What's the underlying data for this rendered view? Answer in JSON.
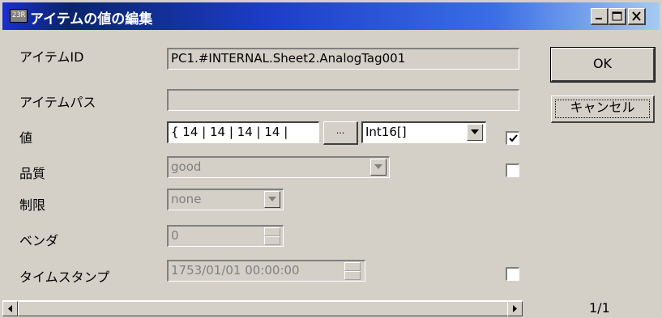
{
  "window": {
    "title": "アイテムの値の編集",
    "app_icon_text": "23R",
    "controls": [
      "minimize-icon",
      "maximize-icon",
      "close-icon"
    ]
  },
  "labels": {
    "item_id": "アイテムID",
    "item_path": "アイテムパス",
    "value": "値",
    "quality": "品質",
    "limit": "制限",
    "vendor": "ベンダ",
    "timestamp": "タイムスタンプ"
  },
  "fields": {
    "item_id": "PC1.#INTERNAL.Sheet2.AnalogTag001",
    "item_path": "",
    "value": "{ 14 | 14 | 14 | 14 |",
    "value_type": "Int16[]",
    "quality": "good",
    "limit": "none",
    "vendor": "0",
    "timestamp": "1753/01/01 00:00:00"
  },
  "checkboxes": {
    "value_checked": true,
    "quality_checked": false,
    "timestamp_checked": false
  },
  "buttons": {
    "ok": "OK",
    "cancel": "キャンセル",
    "browse": "..."
  },
  "footer": {
    "page": "1/1"
  }
}
